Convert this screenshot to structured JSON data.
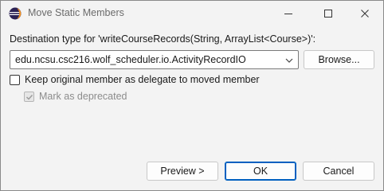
{
  "window": {
    "title": "Move Static Members"
  },
  "dialog": {
    "destination_label": "Destination type for 'writeCourseRecords(String, ArrayList<Course>)':",
    "destination_value": "edu.ncsu.csc216.wolf_scheduler.io.ActivityRecordIO",
    "browse_label": "Browse...",
    "keep_delegate_label": "Keep original member as delegate to moved member",
    "keep_delegate_checked": false,
    "mark_deprecated_label": "Mark as deprecated",
    "mark_deprecated_checked": true,
    "mark_deprecated_enabled": false
  },
  "buttons": {
    "preview_label": "Preview >",
    "ok_label": "OK",
    "cancel_label": "Cancel"
  },
  "icons": {
    "app": "eclipse-icon",
    "minimize": "minimize-icon",
    "maximize": "maximize-icon",
    "close": "close-icon",
    "dropdown": "chevron-down-icon",
    "check": "checkmark-icon"
  },
  "colors": {
    "default_button_border": "#0060c0",
    "eclipse_purple": "#2c2255",
    "eclipse_orange": "#f7941e"
  }
}
